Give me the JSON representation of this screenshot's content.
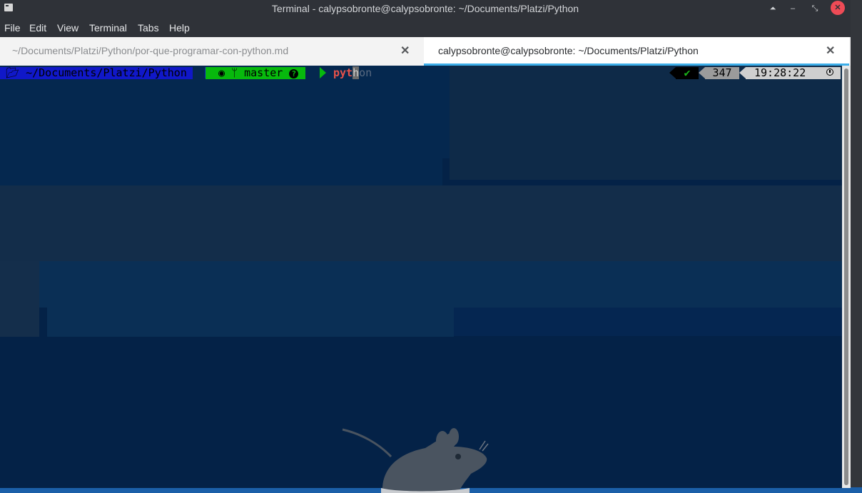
{
  "window": {
    "title": "Terminal - calypsobronte@calypsobronte: ~/Documents/Platzi/Python",
    "buttons": {
      "keep_above": "⏶",
      "minimize": "–",
      "maximize": "⤡",
      "close": "✕"
    }
  },
  "menu": [
    "File",
    "Edit",
    "View",
    "Terminal",
    "Tabs",
    "Help"
  ],
  "tabs": [
    {
      "label": "~/Documents/Platzi/Python/por-que-programar-con-python.md",
      "close": "✕",
      "active": false
    },
    {
      "label": "calypsobronte@calypsobronte: ~/Documents/Platzi/Python",
      "close": "✕",
      "active": true
    }
  ],
  "prompt": {
    "folder_icon": "folder-open-icon",
    "path": "~/Documents/Platzi/Python",
    "git_icon": "github-icon",
    "branch_icon": "git-branch-icon",
    "branch": "master",
    "status_icon": "question-icon",
    "status_glyph": "?",
    "typed": "pyt",
    "cursor_char": "h",
    "suggestion": "on",
    "right": {
      "status": "✔",
      "history_count": "347",
      "time": "19:28:22",
      "time_icon": "clock-icon"
    }
  },
  "colors": {
    "terminal_bg": "#042247",
    "path_bg": "#1018c8",
    "git_bg": "#07b90d",
    "command": "#e8524a",
    "tab_accent": "#3daee9",
    "close_button": "#ee4b56"
  }
}
